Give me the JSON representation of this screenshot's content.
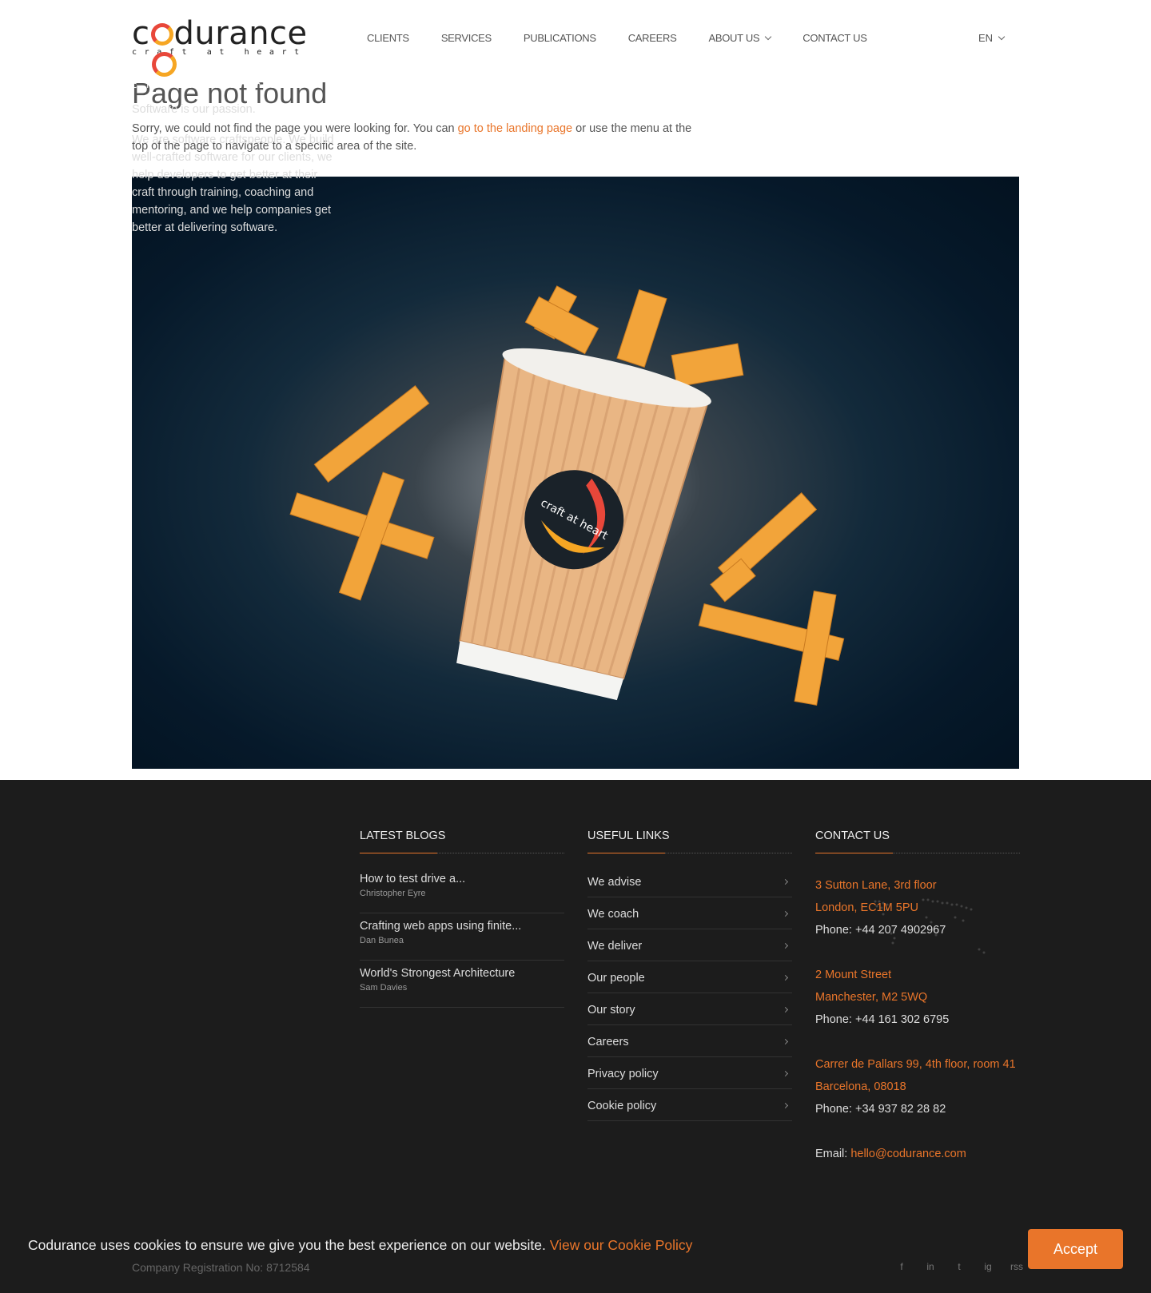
{
  "brand": {
    "name": "codurance",
    "tagline": "craft at heart",
    "accent": "#e9752a"
  },
  "nav": {
    "items": [
      "CLIENTS",
      "SERVICES",
      "PUBLICATIONS",
      "CAREERS",
      "ABOUT US",
      "CONTACT US"
    ],
    "language": "EN"
  },
  "main": {
    "title": "Page not found",
    "intro_before": "Sorry, we could not find the page you were looking for. You can ",
    "intro_link": "go to the landing page",
    "intro_after": " or use the menu at the top of the page to navigate to a specific area of the site.",
    "hero_cup_label": "craft at heart"
  },
  "footer": {
    "tagline": "Software is our passion.",
    "about": "We are software craftspeople. We build well-crafted software for our clients, we help developers to get better at their craft through training, coaching and mentoring, and we help companies get better at delivering software.",
    "blogs_heading": "LATEST BLOGS",
    "blogs": [
      {
        "title": "How to test drive a...",
        "author": "Christopher Eyre"
      },
      {
        "title": "Crafting web apps using finite...",
        "author": "Dan Bunea"
      },
      {
        "title": "World's Strongest Architecture",
        "author": "Sam Davies"
      }
    ],
    "links_heading": "USEFUL LINKS",
    "links": [
      "We advise",
      "We coach",
      "We deliver",
      "Our people",
      "Our story",
      "Careers",
      "Privacy policy",
      "Cookie policy"
    ],
    "contact_heading": "CONTACT US",
    "offices": [
      {
        "line1": "3 Sutton Lane, 3rd floor",
        "line2": "London, EC1M 5PU",
        "phone": "Phone: +44 207 4902967"
      },
      {
        "line1": "2 Mount Street",
        "line2": "Manchester, M2 5WQ",
        "phone": "Phone: +44 161 302 6795"
      },
      {
        "line1": "Carrer de Pallars 99, 4th floor, room 41",
        "line2": "Barcelona, 08018",
        "phone": "Phone: +34 937 82 28 82"
      }
    ],
    "email_label": "Email: ",
    "email": "hello@codurance.com",
    "registration": "Company Registration No: 8712584",
    "socials": [
      "f",
      "in",
      "t",
      "ig",
      "rss"
    ]
  },
  "cookie": {
    "text": "Codurance uses cookies to ensure we give you the best experience on our website. ",
    "link": "View our Cookie Policy",
    "accept": "Accept"
  }
}
